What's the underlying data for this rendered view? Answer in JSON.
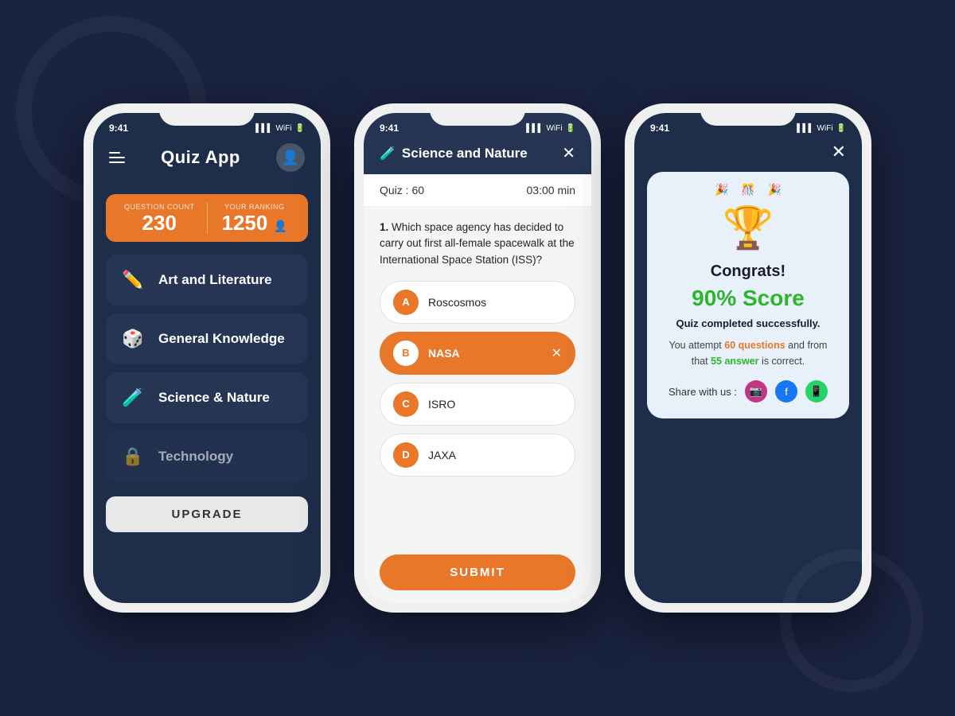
{
  "background": "#1a2340",
  "phone1": {
    "statusTime": "9:41",
    "title": "Quiz App",
    "stats": {
      "questionCount": {
        "label": "Question Count",
        "value": "230"
      },
      "ranking": {
        "label": "Your Ranking",
        "value": "1250"
      }
    },
    "categories": [
      {
        "id": "art",
        "name": "Art and Literature",
        "icon": "✏️",
        "locked": false
      },
      {
        "id": "general",
        "name": "General Knowledge",
        "icon": "🎲",
        "locked": false
      },
      {
        "id": "science",
        "name": "Science & Nature",
        "icon": "🧪",
        "locked": false
      },
      {
        "id": "tech",
        "name": "Technology",
        "icon": "🔒",
        "locked": true
      }
    ],
    "upgradeButton": "UPGRADE"
  },
  "phone2": {
    "statusTime": "9:41",
    "headerIcon": "🧪",
    "headerTitle": "Science and Nature",
    "quizNumber": "Quiz : 60",
    "timer": "03:00 min",
    "question": {
      "number": "1.",
      "text": "Which space agency has decided to carry out first all-female spacewalk at the International Space Station (ISS)?"
    },
    "options": [
      {
        "letter": "A",
        "text": "Roscosmos",
        "selected": false
      },
      {
        "letter": "B",
        "text": "NASA",
        "selected": true
      },
      {
        "letter": "C",
        "text": "ISRO",
        "selected": false
      },
      {
        "letter": "D",
        "text": "JAXA",
        "selected": false
      }
    ],
    "submitButton": "SUBMIT"
  },
  "phone3": {
    "statusTime": "9:41",
    "card": {
      "trophyEmoji": "🏆",
      "confetti": [
        "🎊",
        "🎉",
        "🎊"
      ],
      "congratsText": "Congrats!",
      "scoreText": "90% Score",
      "completedText": "Quiz completed successfully.",
      "attemptInfo": {
        "prefix": "You attempt ",
        "questions": "60 questions",
        "middle": " and\nfrom that ",
        "answers": "55 answer",
        "suffix": " is correct."
      },
      "shareLabel": "Share with us :",
      "shareIcons": [
        "instagram",
        "facebook",
        "whatsapp"
      ]
    }
  }
}
